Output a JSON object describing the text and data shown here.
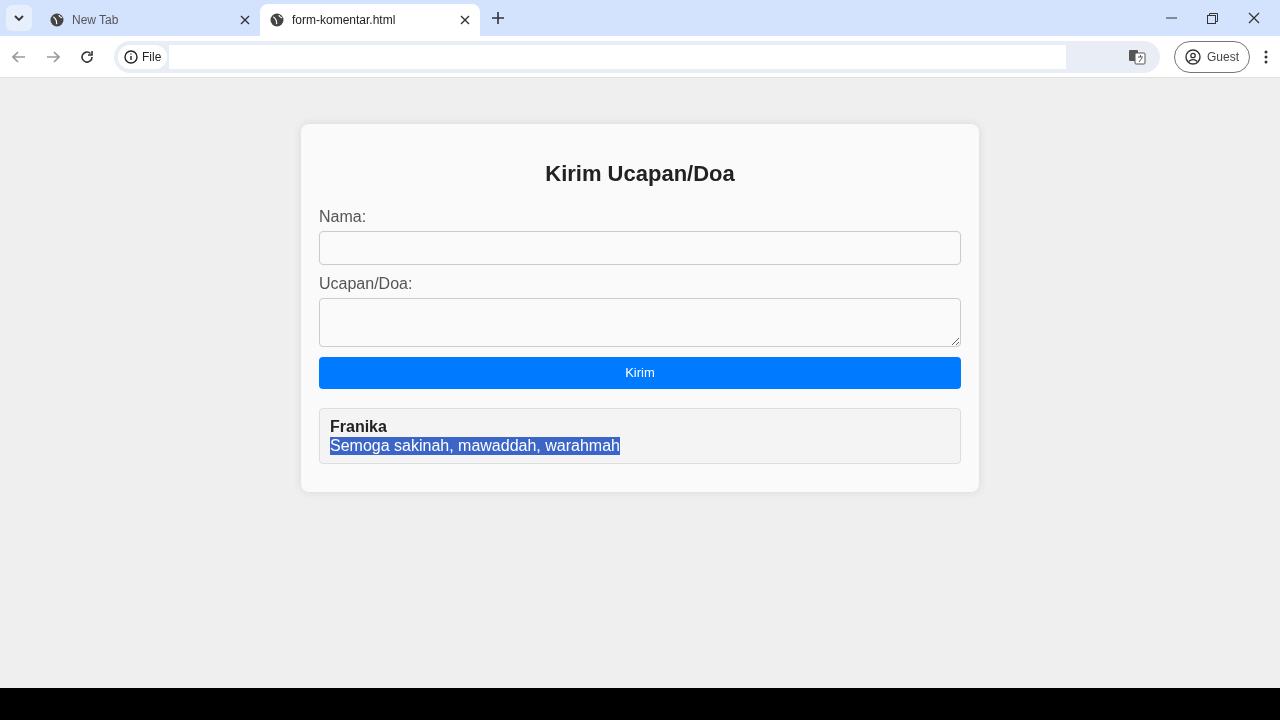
{
  "tabs": [
    {
      "title": "New Tab",
      "selected": false
    },
    {
      "title": "form-komentar.html",
      "selected": true
    }
  ],
  "address_bar": {
    "badge": "File"
  },
  "profile": {
    "label": "Guest"
  },
  "form": {
    "title": "Kirim Ucapan/Doa",
    "fields": [
      {
        "kind": "input",
        "label": "Nama:"
      },
      {
        "kind": "textarea",
        "label": "Ucapan/Doa:"
      }
    ],
    "submit": "Kirim"
  },
  "comments": [
    {
      "name": "Franika",
      "message": "Semoga sakinah, mawaddah, warahmah",
      "highlighted": true
    }
  ]
}
